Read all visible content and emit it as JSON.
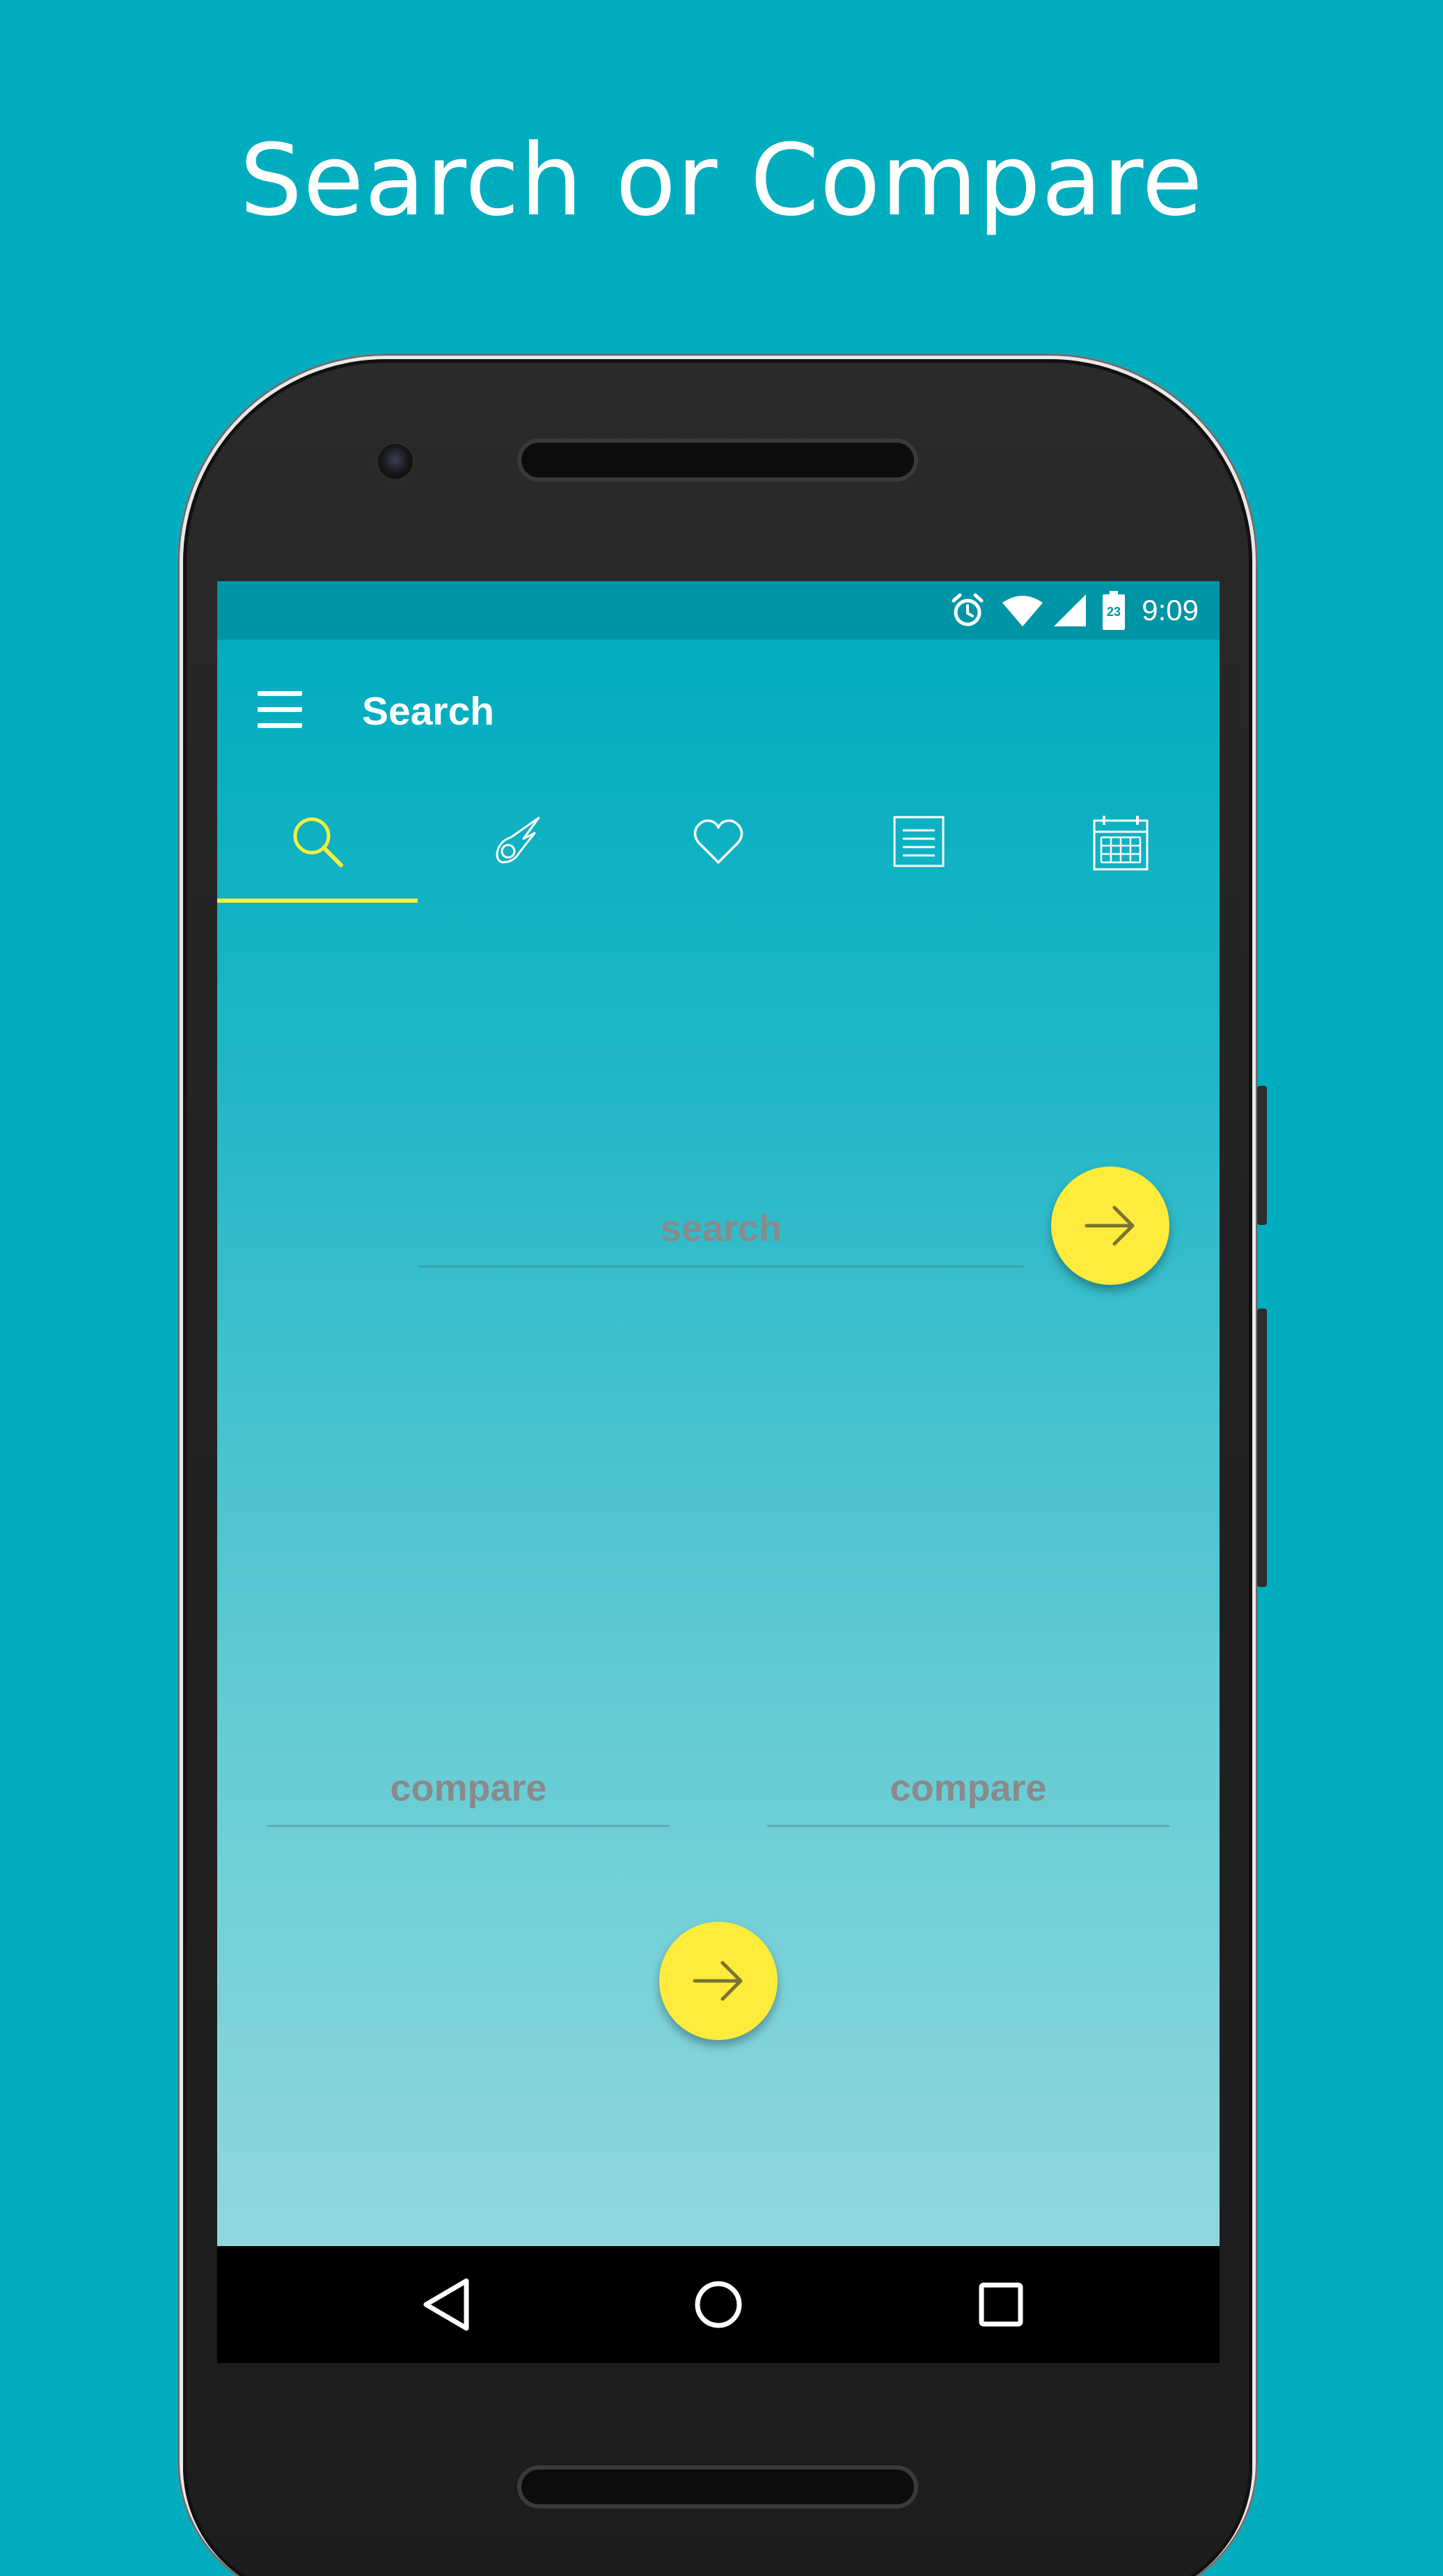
{
  "headline": "Search or Compare",
  "status_bar": {
    "time": "9:09",
    "calendar_day": "23",
    "icons": [
      "alarm-icon",
      "wifi-icon",
      "signal-icon",
      "battery-icon"
    ]
  },
  "toolbar": {
    "menu_icon": "hamburger-menu-icon",
    "title": "Search"
  },
  "tabs": [
    {
      "icon": "search-icon",
      "selected": true
    },
    {
      "icon": "comet-icon",
      "selected": false
    },
    {
      "icon": "heart-icon",
      "selected": false
    },
    {
      "icon": "list-icon",
      "selected": false
    },
    {
      "icon": "calendar-icon",
      "selected": false
    }
  ],
  "search": {
    "placeholder": "search"
  },
  "compare": {
    "left_placeholder": "compare",
    "right_placeholder": "compare"
  },
  "buttons": {
    "search_go_icon": "arrow-right-icon",
    "compare_go_icon": "arrow-right-icon"
  },
  "navigation": [
    "back-icon",
    "home-icon",
    "recents-icon"
  ],
  "colors": {
    "background": "#00adbf",
    "status_bar": "#0095a6",
    "accent": "#ffeb3b",
    "tab_indicator": "#f5ee3c",
    "placeholder_text": "#8a8a8a"
  }
}
